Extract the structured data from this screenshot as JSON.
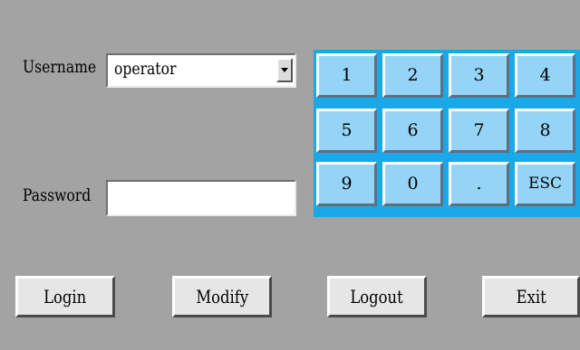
{
  "form": {
    "username_label": "Username",
    "username_value": "operator",
    "password_label": "Password",
    "password_value": ""
  },
  "keypad": {
    "keys": [
      {
        "label": "1",
        "col": 0,
        "row": 0
      },
      {
        "label": "2",
        "col": 1,
        "row": 0
      },
      {
        "label": "3",
        "col": 2,
        "row": 0
      },
      {
        "label": "4",
        "col": 3,
        "row": 0
      },
      {
        "label": "5",
        "col": 0,
        "row": 1
      },
      {
        "label": "6",
        "col": 1,
        "row": 1
      },
      {
        "label": "7",
        "col": 2,
        "row": 1
      },
      {
        "label": "8",
        "col": 3,
        "row": 1
      },
      {
        "label": "9",
        "col": 0,
        "row": 2
      },
      {
        "label": "0",
        "col": 1,
        "row": 2
      },
      {
        "label": ".",
        "col": 2,
        "row": 2
      },
      {
        "label": "ESC",
        "col": 3,
        "row": 2
      }
    ]
  },
  "buttons": {
    "login": "Login",
    "modify": "Modify",
    "logout": "Logout",
    "exit": "Exit"
  },
  "colors": {
    "background": "#a3a3a3",
    "keypad_frame": "#1aa9e8",
    "key_face": "#95d4f6",
    "button_face": "#e6e6e6"
  }
}
